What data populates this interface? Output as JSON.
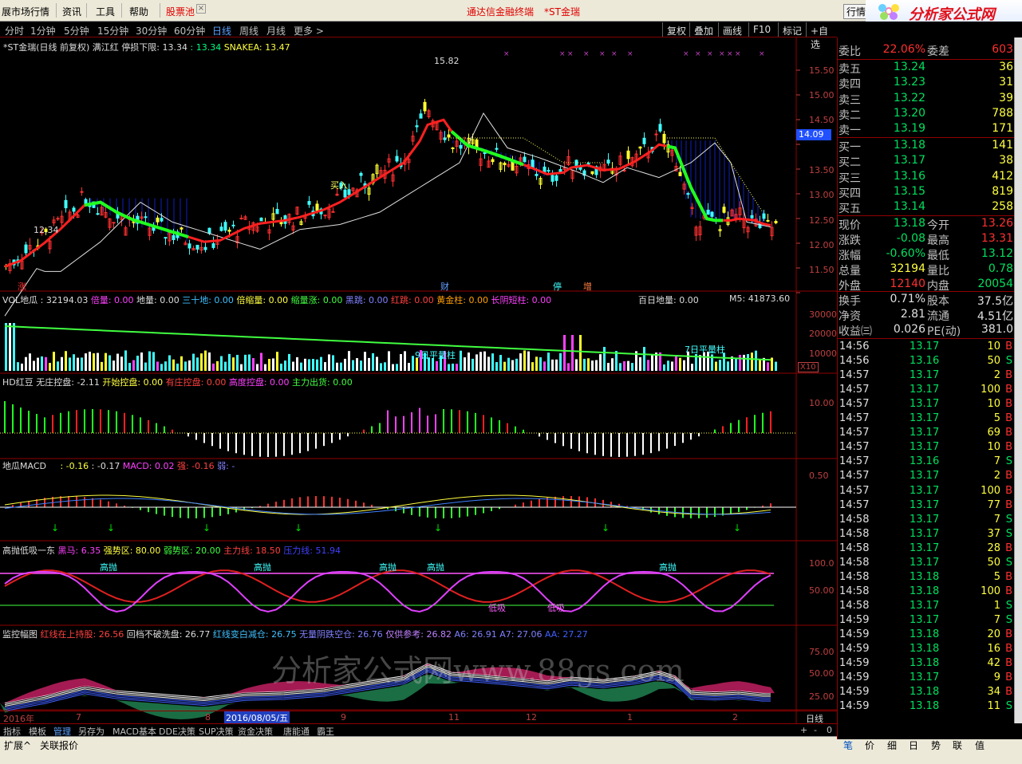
{
  "menu": {
    "items": [
      "展市场行情",
      "资讯",
      "工具",
      "帮助",
      "股票池"
    ],
    "center": "通达信金融终端",
    "stock": "*ST金瑞",
    "right": "行情"
  },
  "logo": {
    "title": "分析家公式网",
    "url": "www.88gs.com"
  },
  "periods": [
    "分时",
    "1分钟",
    "5分钟",
    "15分钟",
    "30分钟",
    "60分钟",
    "日线",
    "周线",
    "月线",
    "更多 >"
  ],
  "active_period": "日线",
  "right_buttons": [
    "复权",
    "叠加",
    "画线",
    "F10",
    "标记",
    "+自选"
  ],
  "main_header": {
    "title": "*ST金瑞(日线 前复权) 满江红",
    "limit_label": "停损下限:",
    "limit": "13.34",
    "v2": "13.34",
    "snake_label": "SNAKEA:",
    "snake": "13.47"
  },
  "main_axis": [
    "15.50",
    "15.00",
    "14.50",
    "14.00",
    "13.50",
    "13.00",
    "12.50",
    "12.00",
    "11.50"
  ],
  "price_tag": "14.09",
  "annotations": {
    "high": "15.82",
    "low": "12.34",
    "buy": "买入",
    "zhang": "涨",
    "cai": "财",
    "ting": "停",
    "zeng": "增"
  },
  "vol_header": {
    "label": "VOL地瓜",
    "v": ": 32194.03",
    "beiliang": "倍量: 0.00",
    "diliang": "地量: 0.00",
    "sanshi": "三十地: 0.00",
    "beisuo": "倍缩量: 0.00",
    "suozhang": "缩量涨: 0.00",
    "heitiao": "黑跳: 0.00",
    "hongtiao": "红跳: 0.00",
    "huangjin": "黄金柱: 0.00",
    "changyin": "长阴短柱: 0.00",
    "bairi": "百日地量: 0.00",
    "m5": "M5: 41873.60"
  },
  "vol_axis": [
    "30000",
    "20000",
    "10000"
  ],
  "vol_labels": {
    "l9": "9日平量柱",
    "l7": "7日平量柱",
    "x10": "X10"
  },
  "hd_header": {
    "label": "HD红豆",
    "a": "无庄控盘: -2.11",
    "b": "开始控盘: 0.00",
    "c": "有庄控盘: 0.00",
    "d": "高度控盘: 0.00",
    "e": "主力出货: 0.00"
  },
  "hd_axis": "10.00",
  "macd_header": {
    "label": "地瓜MACD",
    "a": ": -0.16",
    "b": ": -0.17",
    "c": "MACD: 0.02",
    "d": "强: -0.16",
    "e": "弱: -"
  },
  "macd_axis": "0.50",
  "gao_header": {
    "label": "高抛低吸一东",
    "a": "黑马: 6.35",
    "b": "强势区: 80.00",
    "c": "弱势区: 20.00",
    "d": "主力线: 18.50",
    "e": "压力线: 51.94"
  },
  "gao_axis": [
    "100.0",
    "50.00"
  ],
  "gao_labels": {
    "gp": "高抛",
    "dx": "低吸"
  },
  "jk_header": {
    "label": "监控幅图",
    "a": "红线在上持股: 26.56",
    "b": "回档不破洗盘: 26.77",
    "c": "红线变白减仓: 26.75",
    "d": "无量阴跌空仓: 26.76",
    "e": "仅供参考: 26.82",
    "f": "A6: 26.91",
    "g": "A7: 27.06",
    "h": "AA: 27.27"
  },
  "jk_axis": [
    "75.00",
    "50.00",
    "25.00"
  ],
  "watermark": "分析家公式网www.88gs.com",
  "date_axis": {
    "year": "2016年",
    "m7": "7",
    "m8": "8",
    "cur": "2016/08/05/五",
    "m9": "9",
    "m11": "11",
    "m12": "12",
    "m1": "1",
    "m2": "2"
  },
  "bottom_tabs": [
    "指标",
    "模板",
    "管理",
    "另存为",
    "MACD基本",
    "DDE决策",
    "SUP决策",
    "资金决策",
    "唐能通",
    "霸王"
  ],
  "bottom_right": {
    "rixian": "日线",
    "plus": "+",
    "minus": "-",
    "zero": "0"
  },
  "status_tabs": [
    "扩展^",
    "关联报价"
  ],
  "right_tabs": [
    "笔",
    "价",
    "细",
    "日",
    "势",
    "联",
    "值"
  ],
  "quote": {
    "weibi": {
      "l": "委比",
      "v1": "22.06%",
      "l2": "委差",
      "v2": "603"
    },
    "sell": [
      {
        "l": "卖五",
        "p": "13.24",
        "v": "36"
      },
      {
        "l": "卖四",
        "p": "13.23",
        "v": "31"
      },
      {
        "l": "卖三",
        "p": "13.22",
        "v": "39"
      },
      {
        "l": "卖二",
        "p": "13.20",
        "v": "788"
      },
      {
        "l": "卖一",
        "p": "13.19",
        "v": "171"
      }
    ],
    "buy": [
      {
        "l": "买一",
        "p": "13.18",
        "v": "141"
      },
      {
        "l": "买二",
        "p": "13.17",
        "v": "38"
      },
      {
        "l": "买三",
        "p": "13.16",
        "v": "412"
      },
      {
        "l": "买四",
        "p": "13.15",
        "v": "819"
      },
      {
        "l": "买五",
        "p": "13.14",
        "v": "258"
      }
    ],
    "stats": [
      {
        "l": "现价",
        "v": "13.18",
        "l2": "今开",
        "v2": "13.26"
      },
      {
        "l": "涨跌",
        "v": "-0.08",
        "l2": "最高",
        "v2": "13.31"
      },
      {
        "l": "涨幅",
        "v": "-0.60%",
        "l2": "最低",
        "v2": "13.12"
      },
      {
        "l": "总量",
        "v": "32194",
        "l2": "量比",
        "v2": "0.78"
      },
      {
        "l": "外盘",
        "v": "12140",
        "l2": "内盘",
        "v2": "20054"
      }
    ],
    "fin": [
      {
        "l": "换手",
        "v": "0.71%",
        "l2": "股本",
        "v2": "37.5亿"
      },
      {
        "l": "净资",
        "v": "2.81",
        "l2": "流通",
        "v2": "4.51亿"
      },
      {
        "l": "收益㈢",
        "v": "0.026",
        "l2": "PE(动)",
        "v2": "381.0"
      }
    ]
  },
  "ticks": [
    [
      "14:56",
      "13.17",
      "10",
      "B"
    ],
    [
      "14:56",
      "13.16",
      "50",
      "S"
    ],
    [
      "14:57",
      "13.17",
      "2",
      "B"
    ],
    [
      "14:57",
      "13.17",
      "100",
      "B"
    ],
    [
      "14:57",
      "13.17",
      "10",
      "B"
    ],
    [
      "14:57",
      "13.17",
      "5",
      "B"
    ],
    [
      "14:57",
      "13.17",
      "69",
      "B"
    ],
    [
      "14:57",
      "13.17",
      "10",
      "B"
    ],
    [
      "14:57",
      "13.16",
      "7",
      "S"
    ],
    [
      "14:57",
      "13.17",
      "2",
      "B"
    ],
    [
      "14:57",
      "13.17",
      "100",
      "B"
    ],
    [
      "14:57",
      "13.17",
      "77",
      "B"
    ],
    [
      "14:58",
      "13.17",
      "7",
      "S"
    ],
    [
      "14:58",
      "13.17",
      "37",
      "S"
    ],
    [
      "14:58",
      "13.17",
      "28",
      "B"
    ],
    [
      "14:58",
      "13.17",
      "50",
      "S"
    ],
    [
      "14:58",
      "13.18",
      "5",
      "B"
    ],
    [
      "14:58",
      "13.18",
      "100",
      "B"
    ],
    [
      "14:58",
      "13.17",
      "1",
      "S"
    ],
    [
      "14:59",
      "13.17",
      "7",
      "S"
    ],
    [
      "14:59",
      "13.18",
      "20",
      "B"
    ],
    [
      "14:59",
      "13.18",
      "16",
      "B"
    ],
    [
      "14:59",
      "13.18",
      "42",
      "B"
    ],
    [
      "14:59",
      "13.17",
      "9",
      "B"
    ],
    [
      "14:59",
      "13.18",
      "34",
      "B"
    ],
    [
      "14:59",
      "13.18",
      "11",
      "S"
    ]
  ]
}
